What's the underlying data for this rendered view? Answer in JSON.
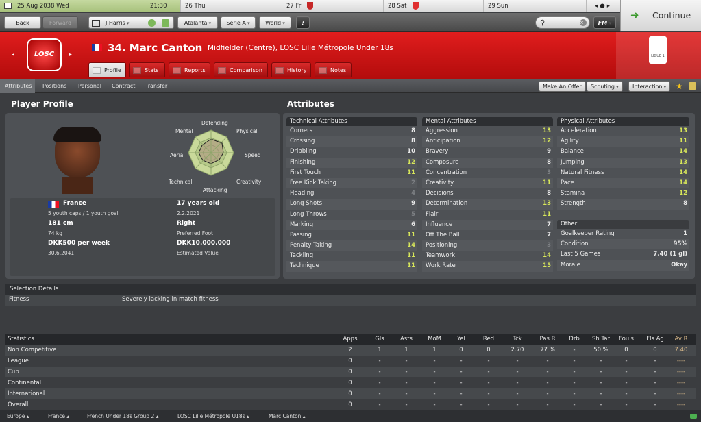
{
  "calendar": {
    "today": "25 Aug 2038 Wed",
    "time": "21:30",
    "days": [
      "26 Thu",
      "27 Fri",
      "28 Sat",
      "29 Sun"
    ]
  },
  "continue_label": "Continue",
  "nav": {
    "back": "Back",
    "forward": "Forward",
    "manager": "J Harris",
    "club": "Atalanta",
    "league": "Serie A",
    "world": "World",
    "help": "?",
    "fm": "FM"
  },
  "player": {
    "number_name": "34. Marc Canton",
    "subtitle": "Midfielder (Centre), LOSC Lille Métropole Under 18s",
    "club_badge": "LOSC",
    "league_badge": "LIGUE 1"
  },
  "tabs": [
    "Profile",
    "Stats",
    "Reports",
    "Comparison",
    "History",
    "Notes"
  ],
  "subnav": {
    "items": [
      "Attributes",
      "Positions",
      "Personal",
      "Contract",
      "Transfer"
    ],
    "make_offer": "Make An Offer",
    "scouting": "Scouting",
    "interaction": "Interaction"
  },
  "profile": {
    "title": "Player Profile",
    "radar_labels": [
      "Defending",
      "Physical",
      "Speed",
      "Creativity",
      "Attacking",
      "Technical",
      "Aerial",
      "Mental"
    ],
    "nationality": "France",
    "caps": "5 youth caps / 1 youth goal",
    "age": "17 years old",
    "dob": "2.2.2021",
    "height": "181 cm",
    "weight": "74 kg",
    "foot": "Right",
    "foot_label": "Preferred Foot",
    "wage": "DKK500 per week",
    "contract_end": "30.6.2041",
    "value": "DKK10.000.000",
    "value_label": "Estimated Value"
  },
  "attributes": {
    "title": "Attributes",
    "technical": {
      "title": "Technical Attributes",
      "rows": [
        [
          "Corners",
          "8"
        ],
        [
          "Crossing",
          "8"
        ],
        [
          "Dribbling",
          "10"
        ],
        [
          "Finishing",
          "12"
        ],
        [
          "First Touch",
          "11"
        ],
        [
          "Free Kick Taking",
          "2"
        ],
        [
          "Heading",
          "4"
        ],
        [
          "Long Shots",
          "9"
        ],
        [
          "Long Throws",
          "5"
        ],
        [
          "Marking",
          "6"
        ],
        [
          "Passing",
          "11"
        ],
        [
          "Penalty Taking",
          "14"
        ],
        [
          "Tackling",
          "11"
        ],
        [
          "Technique",
          "11"
        ]
      ]
    },
    "mental": {
      "title": "Mental Attributes",
      "rows": [
        [
          "Aggression",
          "13"
        ],
        [
          "Anticipation",
          "12"
        ],
        [
          "Bravery",
          "9"
        ],
        [
          "Composure",
          "8"
        ],
        [
          "Concentration",
          "3"
        ],
        [
          "Creativity",
          "11"
        ],
        [
          "Decisions",
          "8"
        ],
        [
          "Determination",
          "13"
        ],
        [
          "Flair",
          "11"
        ],
        [
          "Influence",
          "7"
        ],
        [
          "Off The Ball",
          "7"
        ],
        [
          "Positioning",
          "3"
        ],
        [
          "Teamwork",
          "14"
        ],
        [
          "Work Rate",
          "15"
        ]
      ]
    },
    "physical": {
      "title": "Physical Attributes",
      "rows": [
        [
          "Acceleration",
          "13"
        ],
        [
          "Agility",
          "11"
        ],
        [
          "Balance",
          "14"
        ],
        [
          "Jumping",
          "13"
        ],
        [
          "Natural Fitness",
          "14"
        ],
        [
          "Pace",
          "14"
        ],
        [
          "Stamina",
          "12"
        ],
        [
          "Strength",
          "8"
        ]
      ]
    },
    "other": {
      "title": "Other",
      "rows": [
        [
          "Goalkeeper Rating",
          "1"
        ],
        [
          "Condition",
          "95%"
        ],
        [
          "Last 5 Games",
          "7.40 (1 gl)"
        ],
        [
          "Morale",
          "Okay"
        ]
      ]
    }
  },
  "selection": {
    "title": "Selection Details",
    "label": "Fitness",
    "value": "Severely lacking in match fitness"
  },
  "stats": {
    "headers": [
      "Statistics",
      "Apps",
      "Gls",
      "Asts",
      "MoM",
      "Yel",
      "Red",
      "Tck",
      "Pas R",
      "Drb",
      "Sh Tar",
      "Fouls",
      "Fls Ag",
      "Av R"
    ],
    "rows": [
      [
        "Non Competitive",
        "2",
        "1",
        "1",
        "1",
        "0",
        "0",
        "2.70",
        "77 %",
        "-",
        "50 %",
        "0",
        "0",
        "7.40"
      ],
      [
        "League",
        "0",
        "-",
        "-",
        "-",
        "-",
        "-",
        "-",
        "-",
        "-",
        "-",
        "-",
        "-",
        "----"
      ],
      [
        "Cup",
        "0",
        "-",
        "-",
        "-",
        "-",
        "-",
        "-",
        "-",
        "-",
        "-",
        "-",
        "-",
        "----"
      ],
      [
        "Continental",
        "0",
        "-",
        "-",
        "-",
        "-",
        "-",
        "-",
        "-",
        "-",
        "-",
        "-",
        "-",
        "----"
      ],
      [
        "International",
        "0",
        "-",
        "-",
        "-",
        "-",
        "-",
        "-",
        "-",
        "-",
        "-",
        "-",
        "-",
        "----"
      ],
      [
        "Overall",
        "0",
        "-",
        "-",
        "-",
        "-",
        "-",
        "-",
        "-",
        "-",
        "-",
        "-",
        "-",
        "----"
      ]
    ]
  },
  "footer": [
    "Europe",
    "France",
    "French Under 18s Group 2",
    "LOSC Lille Métropole U18s",
    "Marc Canton"
  ],
  "colors": {
    "header_red": "#d11616",
    "highlight": "#d7e65a",
    "continue_green": "#3c9a2e"
  }
}
